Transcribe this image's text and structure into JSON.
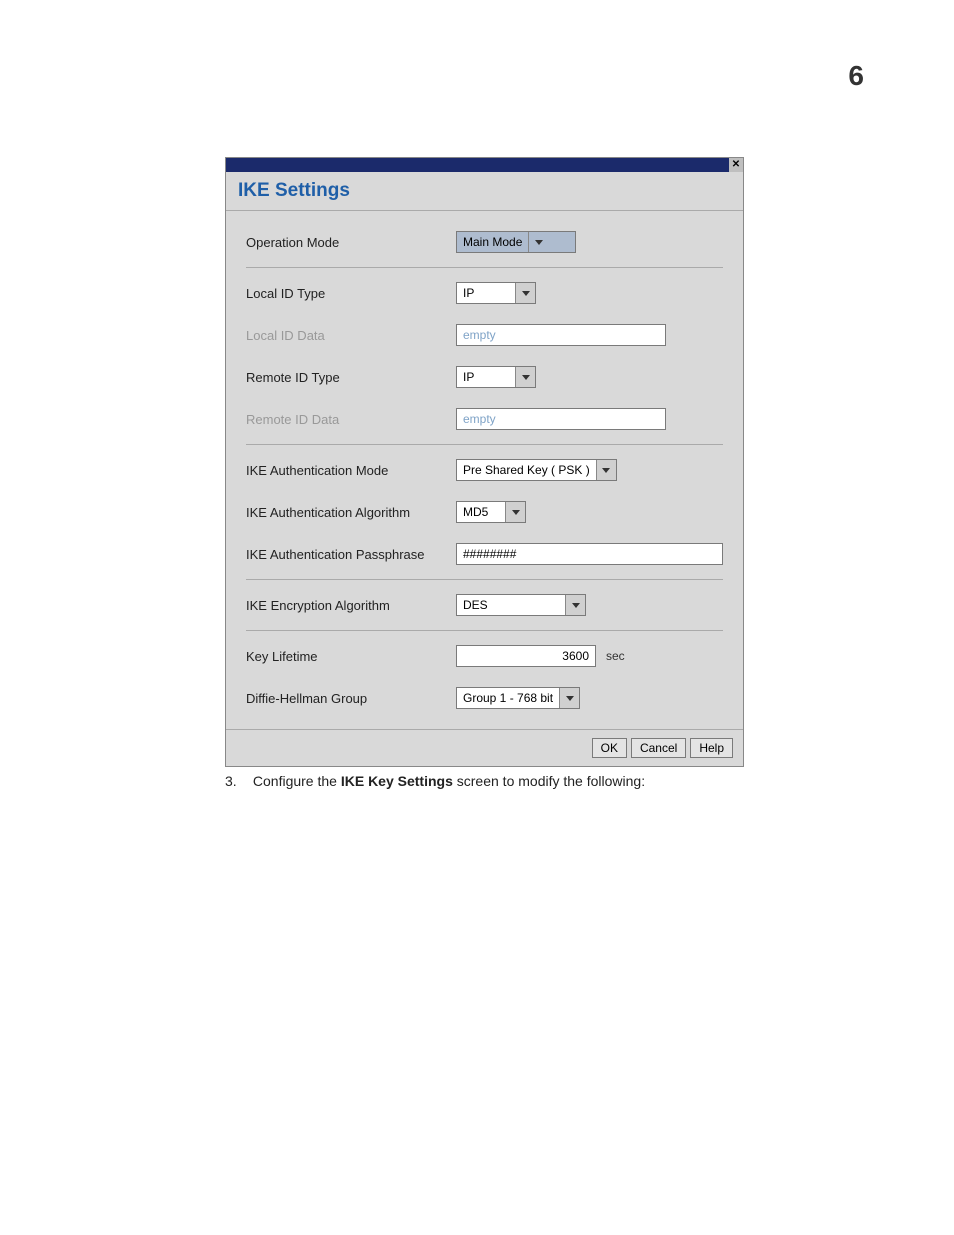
{
  "page_number": "6",
  "dialog": {
    "title": "IKE Settings",
    "operation_mode": {
      "label": "Operation Mode",
      "value": "Main Mode"
    },
    "local_id_type": {
      "label": "Local ID Type",
      "value": "IP"
    },
    "local_id_data": {
      "label": "Local ID Data",
      "placeholder": "empty"
    },
    "remote_id_type": {
      "label": "Remote ID Type",
      "value": "IP"
    },
    "remote_id_data": {
      "label": "Remote ID Data",
      "placeholder": "empty"
    },
    "ike_auth_mode": {
      "label": "IKE Authentication Mode",
      "value": "Pre Shared Key ( PSK )"
    },
    "ike_auth_alg": {
      "label": "IKE Authentication Algorithm",
      "value": "MD5"
    },
    "ike_auth_pass": {
      "label": "IKE Authentication Passphrase",
      "value": "########"
    },
    "ike_enc_alg": {
      "label": "IKE Encryption Algorithm",
      "value": "DES"
    },
    "key_lifetime": {
      "label": "Key Lifetime",
      "value": "3600",
      "unit": "sec"
    },
    "dh_group": {
      "label": "Diffie-Hellman Group",
      "value": "Group 1 - 768 bit"
    },
    "buttons": {
      "ok": "OK",
      "cancel": "Cancel",
      "help": "Help"
    }
  },
  "caption": {
    "num": "3.",
    "pre": "Configure the ",
    "bold": "IKE Key Settings",
    "post": " screen to modify the following:"
  }
}
